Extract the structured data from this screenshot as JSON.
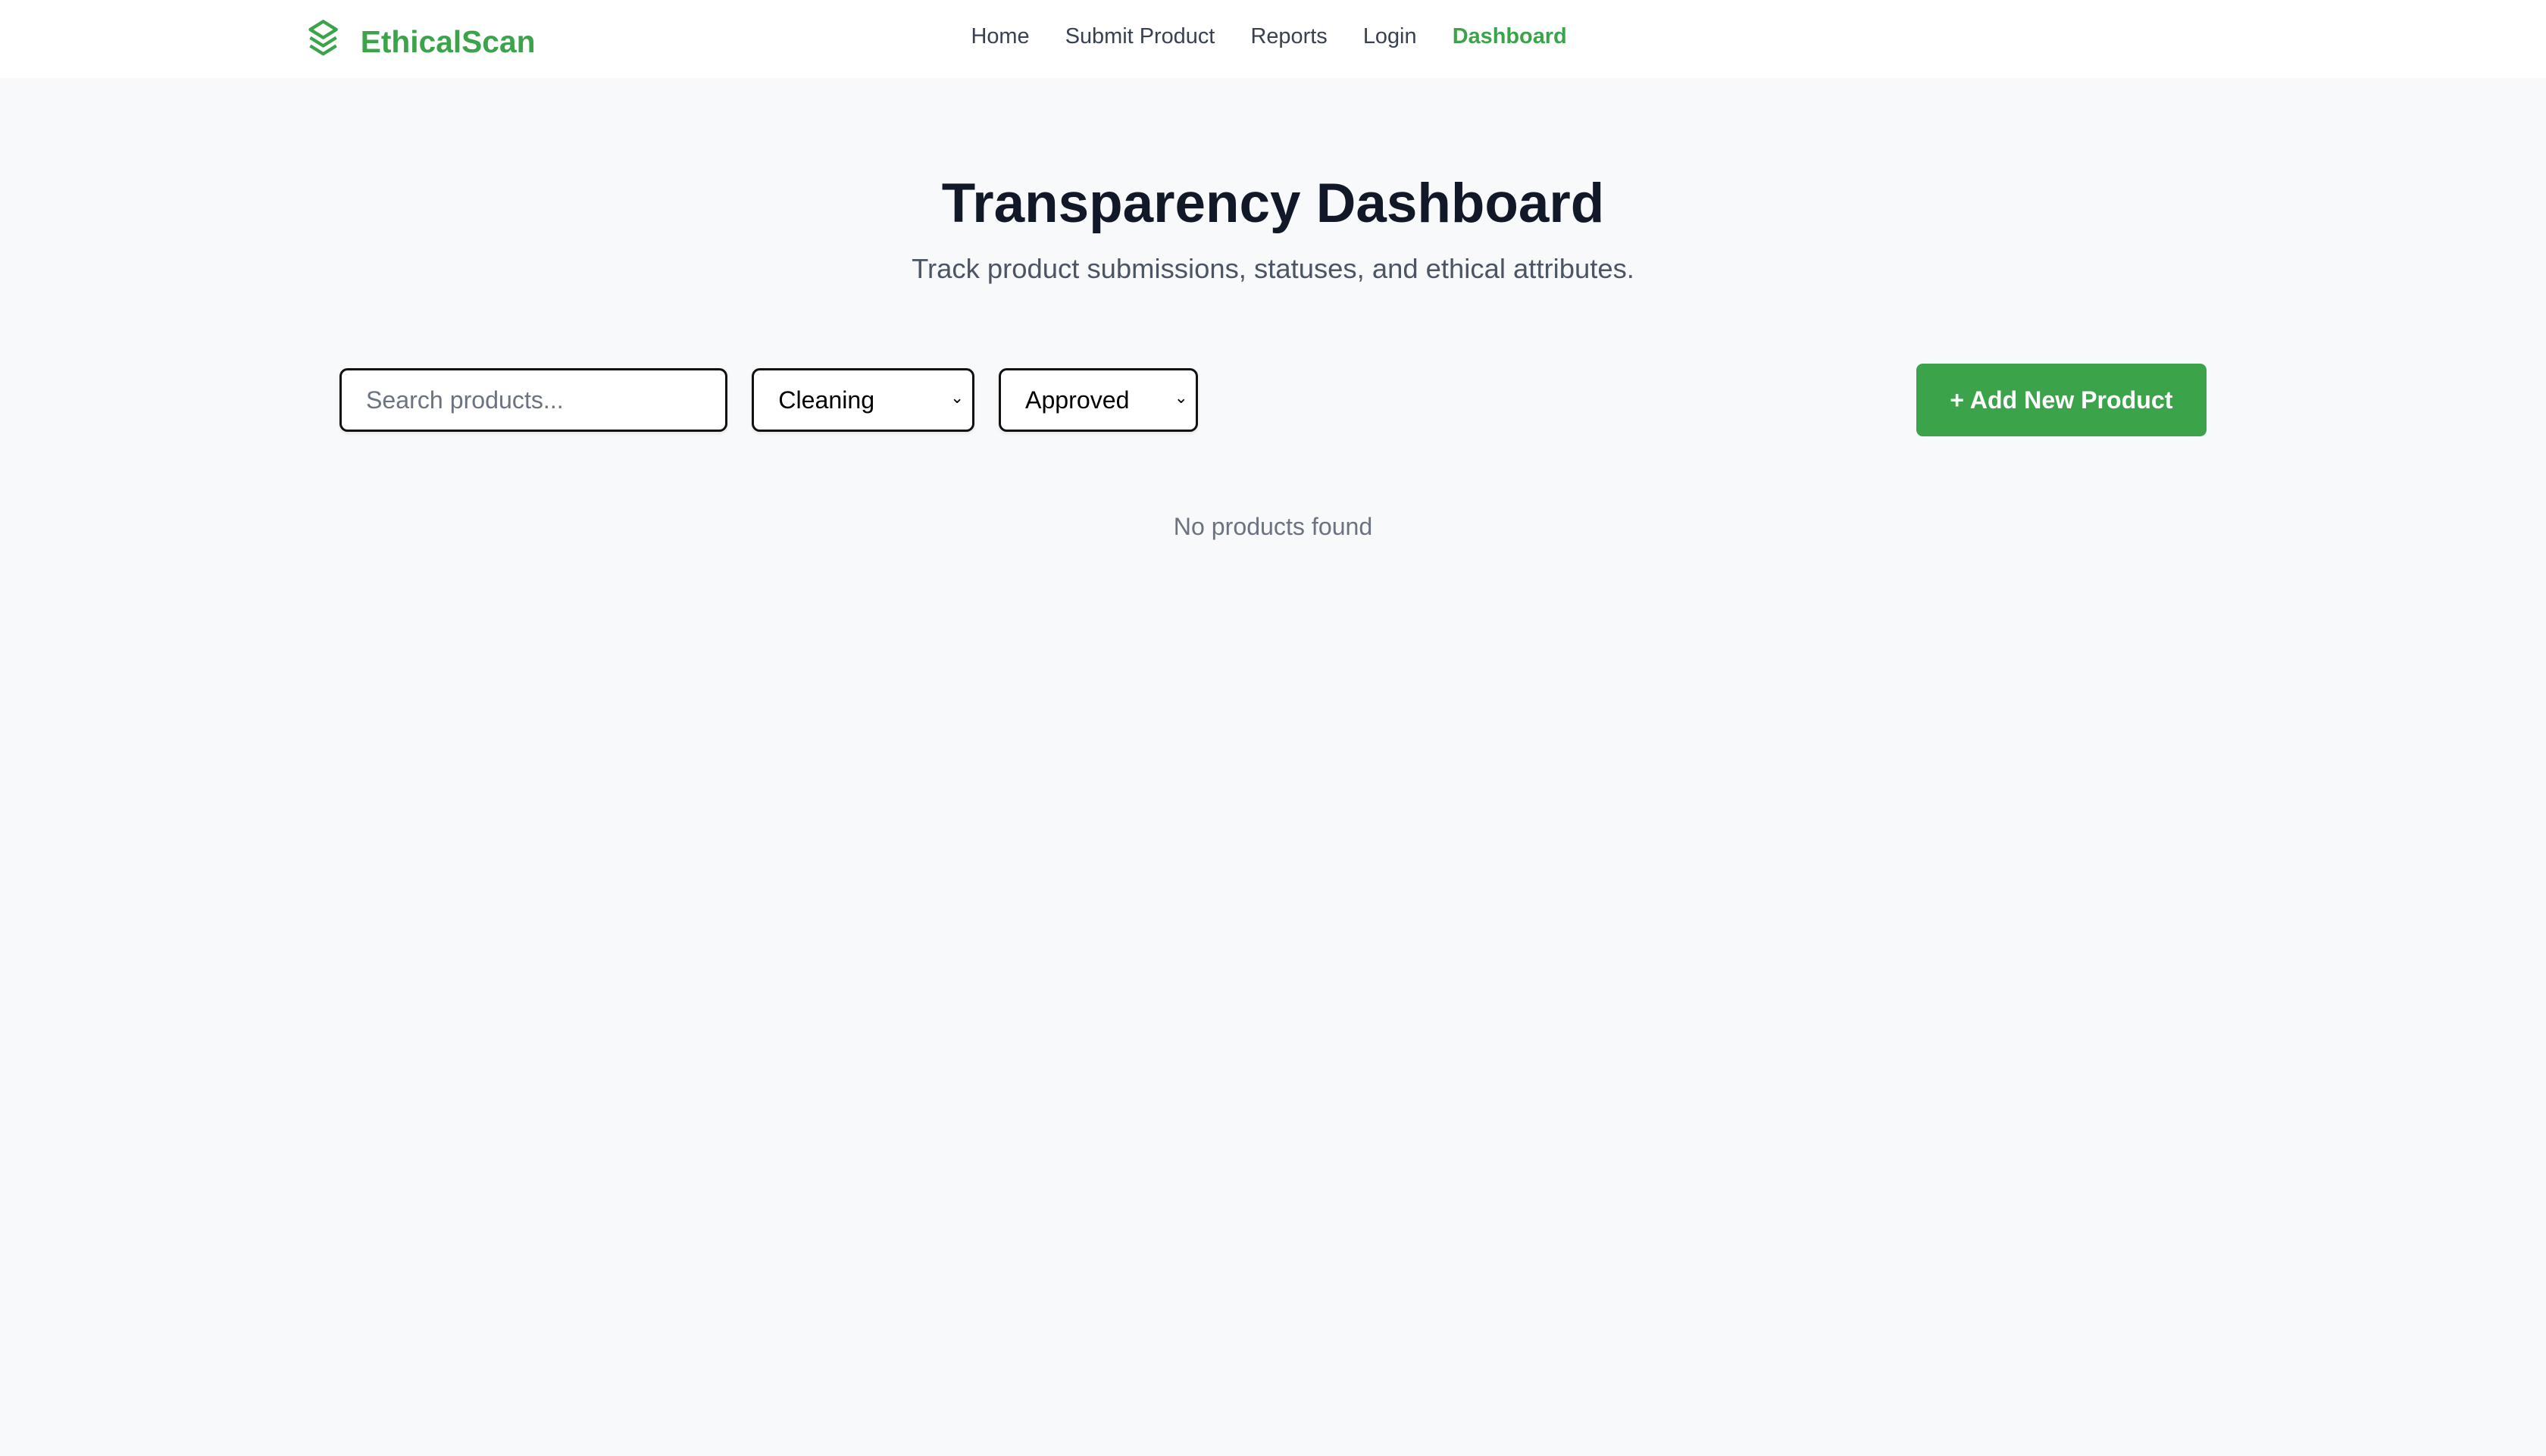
{
  "brand": {
    "name": "EthicalScan",
    "icon": "layers-icon",
    "color": "#3ba34a"
  },
  "nav": [
    {
      "label": "Home"
    },
    {
      "label": "Submit Product"
    },
    {
      "label": "Reports"
    },
    {
      "label": "Login"
    },
    {
      "label": "Dashboard",
      "active": true
    }
  ],
  "page": {
    "title": "Transparency Dashboard",
    "subtitle": "Track product submissions, statuses, and ethical attributes."
  },
  "filters": {
    "search_placeholder": "Search products...",
    "search_value": "",
    "category": "Cleaning",
    "status": "Approved"
  },
  "add_button": "+ Add New Product",
  "empty_message": "No products found"
}
